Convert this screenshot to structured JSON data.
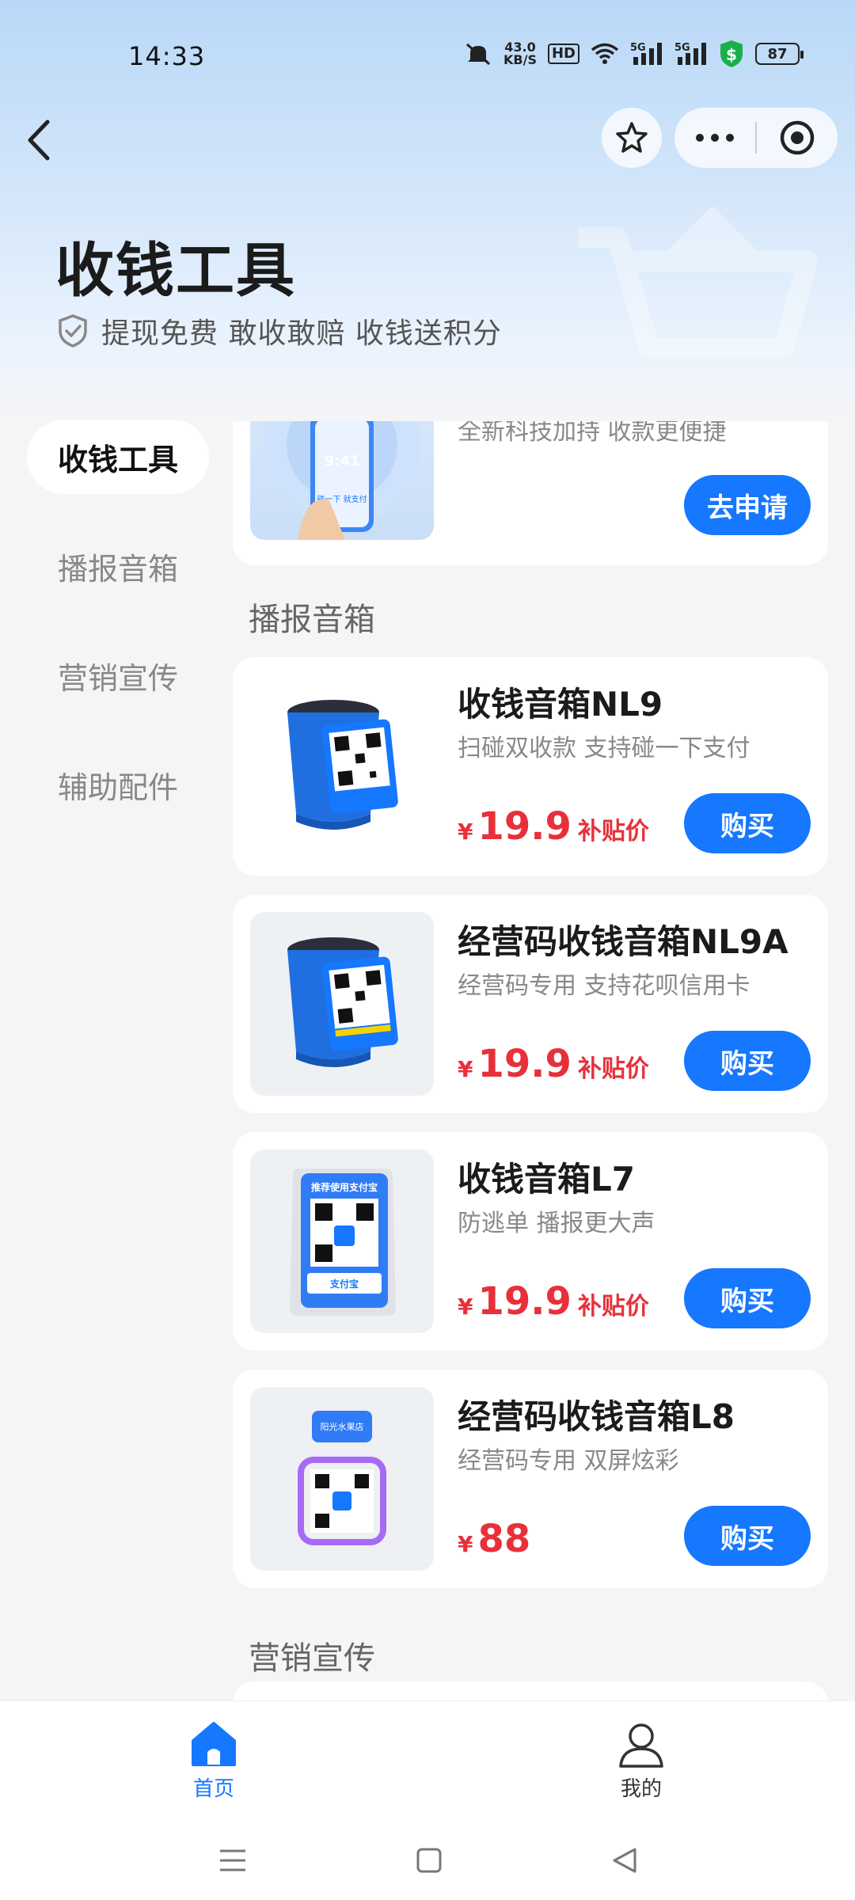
{
  "status_bar": {
    "time": "14:33",
    "net_speed_value": "43.0",
    "net_speed_unit": "KB/S",
    "hd_label": "HD",
    "signal1_label": "5G",
    "signal2_label": "5G",
    "battery": "87"
  },
  "header": {
    "title": "收钱工具",
    "subtitle": "提现免费 敢收敢赔 收钱送积分"
  },
  "sidebar": {
    "items": [
      {
        "label": "收钱工具",
        "active": true
      },
      {
        "label": "播报音箱",
        "active": false
      },
      {
        "label": "营销宣传",
        "active": false
      },
      {
        "label": "辅助配件",
        "active": false
      }
    ]
  },
  "top_card": {
    "desc": "全新科技加持 收款更便捷",
    "phone_time": "9:41",
    "phone_caption": "碰一下 就支付",
    "button": "去申请"
  },
  "sections": {
    "speaker_label": "播报音箱",
    "marketing_label": "营销宣传"
  },
  "products": [
    {
      "title": "收钱音箱NL9",
      "desc": "扫碰双收款 支持碰一下支付",
      "currency": "¥",
      "price": "19.9",
      "tag": "补贴价",
      "button": "购买"
    },
    {
      "title": "经营码收钱音箱NL9A",
      "desc": "经营码专用 支持花呗信用卡",
      "currency": "¥",
      "price": "19.9",
      "tag": "补贴价",
      "button": "购买"
    },
    {
      "title": "收钱音箱L7",
      "desc": "防逃单 播报更大声",
      "currency": "¥",
      "price": "19.9",
      "tag": "补贴价",
      "button": "购买",
      "device_top_text": "推荐使用支付宝",
      "device_brand": "支付宝"
    },
    {
      "title": "经营码收钱音箱L8",
      "desc": "经营码专用 双屏炫彩",
      "currency": "¥",
      "price": "88",
      "tag": "",
      "button": "购买",
      "device_top_text": "阳光水果店"
    }
  ],
  "tabbar": {
    "home": "首页",
    "mine": "我的"
  },
  "colors": {
    "accent": "#1677ff",
    "price": "#e8303a"
  }
}
